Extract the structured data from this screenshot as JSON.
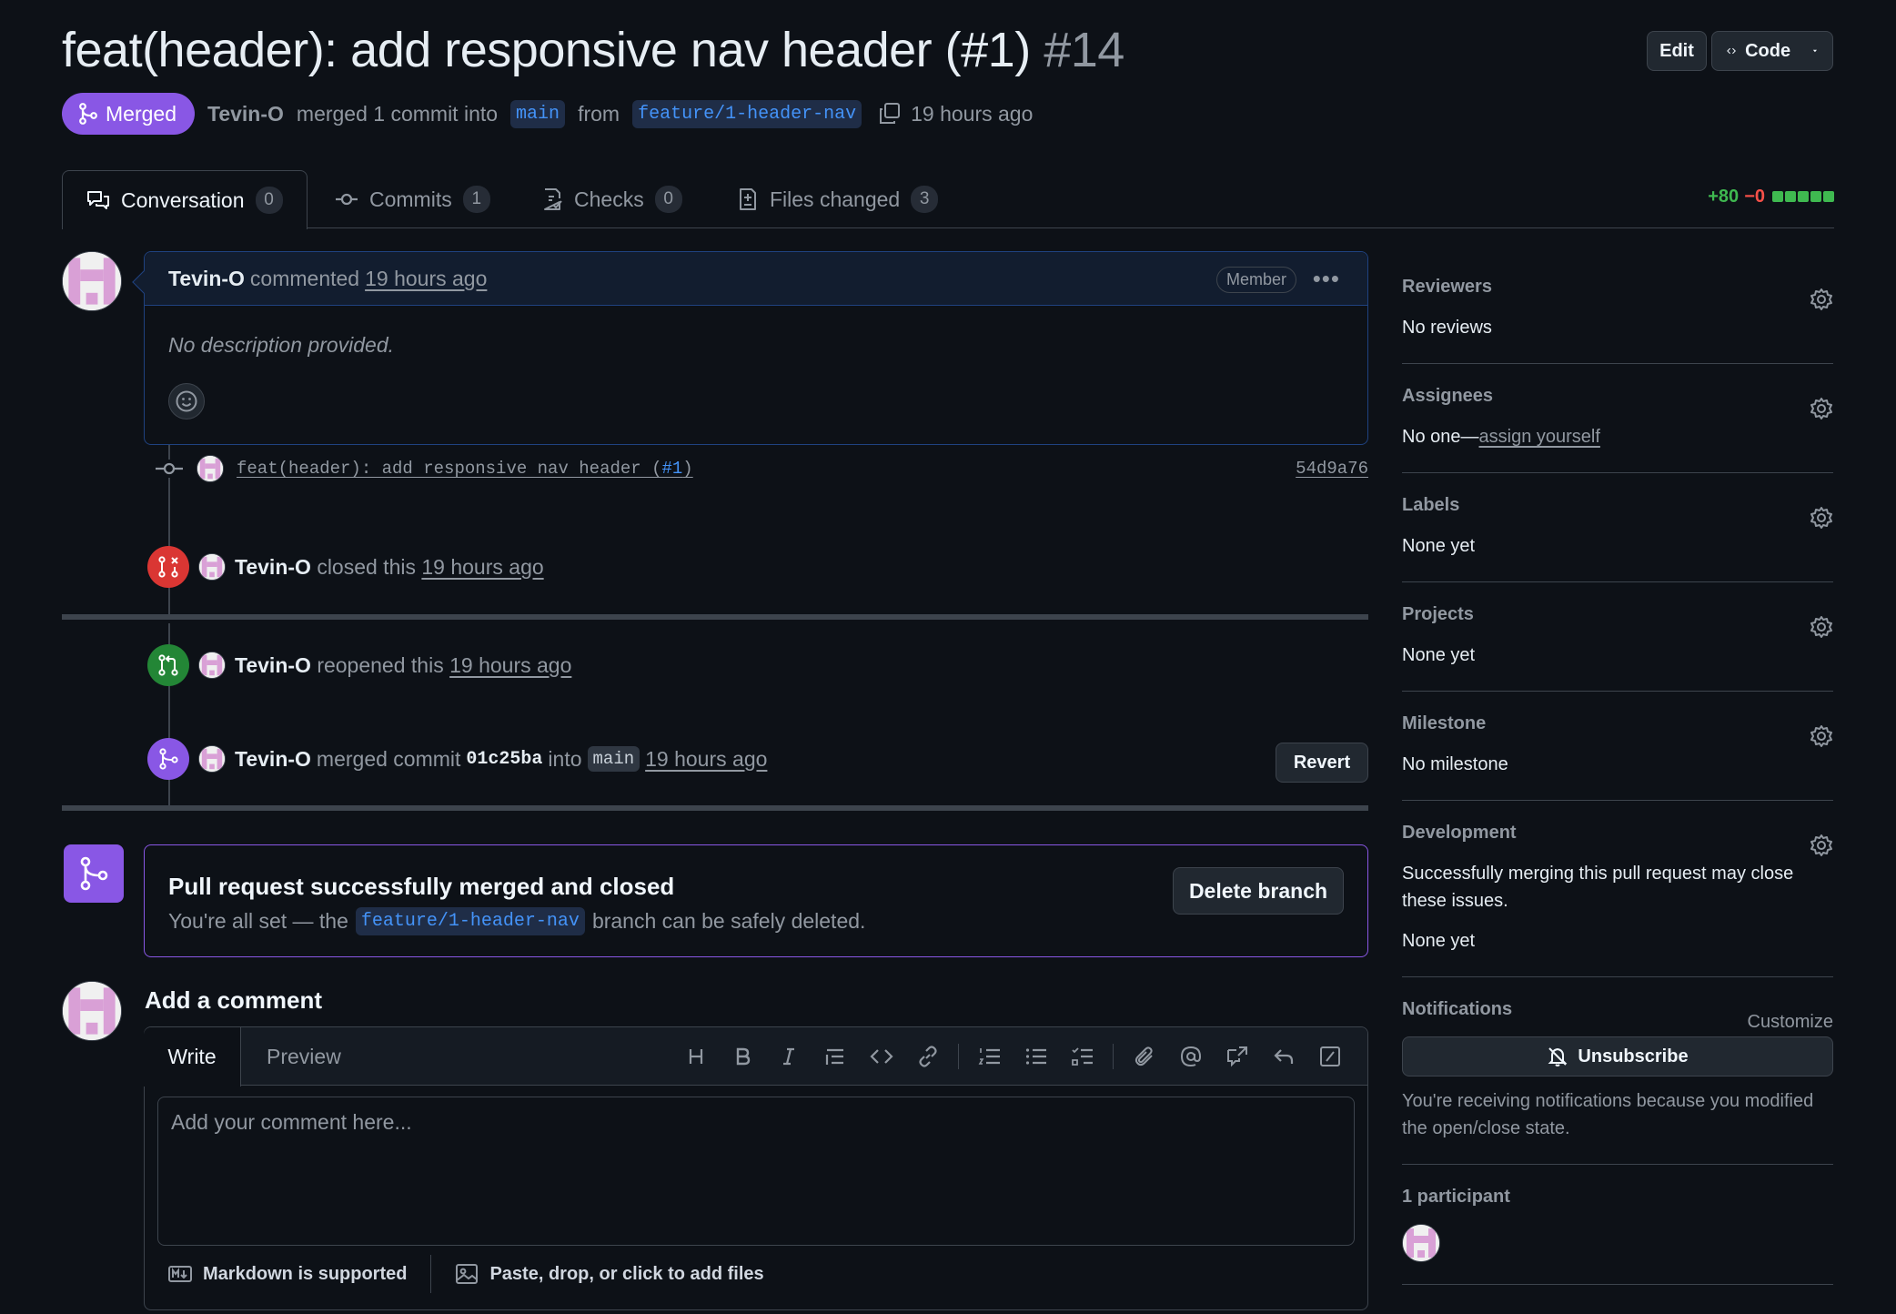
{
  "header": {
    "title": "feat(header): add responsive nav header (#1)",
    "number": "#14",
    "edit_label": "Edit",
    "code_label": "Code"
  },
  "state": {
    "badge": "Merged",
    "author": "Tevin-O",
    "text_merged": "merged 1 commit into",
    "base_branch": "main",
    "text_from": "from",
    "head_branch": "feature/1-header-nav",
    "time": "19 hours ago"
  },
  "tabs": [
    {
      "label": "Conversation",
      "count": "0"
    },
    {
      "label": "Commits",
      "count": "1"
    },
    {
      "label": "Checks",
      "count": "0"
    },
    {
      "label": "Files changed",
      "count": "3"
    }
  ],
  "diffstat": {
    "additions": "+80",
    "deletions": "−0"
  },
  "comment": {
    "author": "Tevin-O",
    "action": "commented",
    "time": "19 hours ago",
    "role": "Member",
    "body": "No description provided."
  },
  "commit": {
    "message": "feat(header): add responsive nav header (",
    "issue": "#1",
    "message_end": ")",
    "sha": "54d9a76"
  },
  "events": {
    "closed": {
      "author": "Tevin-O",
      "action": "closed this",
      "time": "19 hours ago"
    },
    "reopened": {
      "author": "Tevin-O",
      "action": "reopened this",
      "time": "19 hours ago"
    },
    "merged": {
      "author": "Tevin-O",
      "action": "merged commit",
      "sha": "01c25ba",
      "into": "into",
      "branch": "main",
      "time": "19 hours ago",
      "revert_label": "Revert"
    }
  },
  "merge_box": {
    "title": "Pull request successfully merged and closed",
    "sub_pre": "You're all set — the",
    "branch": "feature/1-header-nav",
    "sub_post": "branch can be safely deleted.",
    "delete_label": "Delete branch"
  },
  "editor": {
    "title": "Add a comment",
    "write_tab": "Write",
    "preview_tab": "Preview",
    "placeholder": "Add your comment here...",
    "markdown_note": "Markdown is supported",
    "files_note": "Paste, drop, or click to add files"
  },
  "sidebar": {
    "reviewers": {
      "title": "Reviewers",
      "value": "No reviews"
    },
    "assignees": {
      "title": "Assignees",
      "value": "No one—",
      "link": "assign yourself"
    },
    "labels": {
      "title": "Labels",
      "value": "None yet"
    },
    "projects": {
      "title": "Projects",
      "value": "None yet"
    },
    "milestone": {
      "title": "Milestone",
      "value": "No milestone"
    },
    "development": {
      "title": "Development",
      "desc": "Successfully merging this pull request may close these issues.",
      "value": "None yet"
    },
    "notifications": {
      "title": "Notifications",
      "customize": "Customize",
      "unsubscribe": "Unsubscribe",
      "reason": "You're receiving notifications because you modified the open/close state."
    },
    "participants": {
      "title": "1 participant"
    }
  },
  "colors": {
    "merged_purple": "#8957e5",
    "closed_red": "#da3633",
    "open_green": "#238636",
    "link_blue": "#4493f8"
  }
}
